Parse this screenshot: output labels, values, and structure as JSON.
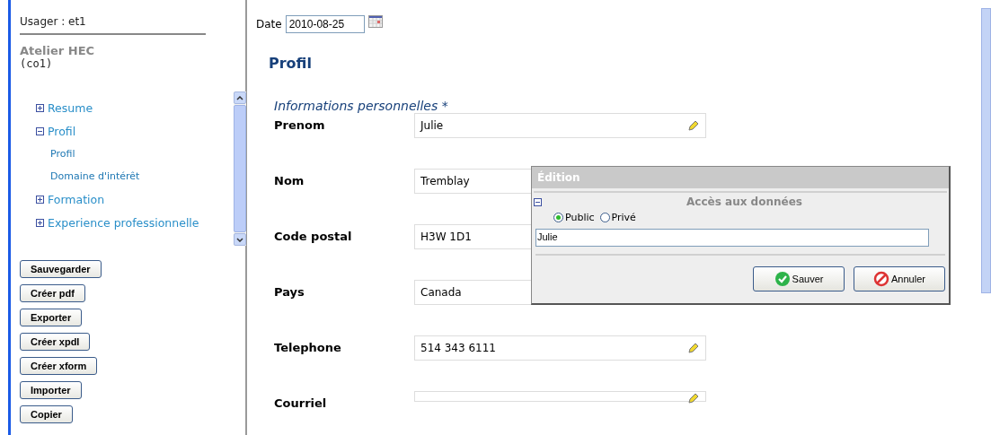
{
  "sidebar": {
    "user": "Usager : et1",
    "org_name": "Atelier HEC",
    "org_code": "(co1)",
    "nav": [
      {
        "label": "Resume",
        "expanded": false
      },
      {
        "label": "Profil",
        "expanded": true,
        "children": [
          {
            "label": "Profil"
          },
          {
            "label": "Domaine d'intérêt"
          }
        ]
      },
      {
        "label": "Formation",
        "expanded": false
      },
      {
        "label": "Experience professionnelle",
        "expanded": false
      }
    ],
    "buttons": [
      "Sauvegarder",
      "Créer pdf",
      "Exporter",
      "Créer xpdl",
      "Créer xform",
      "Importer",
      "Copier"
    ]
  },
  "main": {
    "date_label": "Date",
    "date_value": "2010-08-25",
    "heading": "Profil",
    "section": "Informations personnelles *",
    "fields": [
      {
        "label": "Prenom",
        "value": "Julie"
      },
      {
        "label": "Nom",
        "value": "Tremblay"
      },
      {
        "label": "Code postal",
        "value": "H3W 1D1"
      },
      {
        "label": "Pays",
        "value": "Canada"
      },
      {
        "label": "Telephone",
        "value": "514 343 6111"
      },
      {
        "label": "Courriel"
      }
    ]
  },
  "dialog": {
    "title": "Édition",
    "section": "Accès aux données",
    "section_expanded": true,
    "options": [
      {
        "label": "Public",
        "selected": true
      },
      {
        "label": "Privé",
        "selected": false
      }
    ],
    "value": "Julie",
    "buttons": [
      {
        "kind": "ok",
        "label": "Sauver"
      },
      {
        "kind": "cancel",
        "label": "Annuler"
      }
    ]
  }
}
